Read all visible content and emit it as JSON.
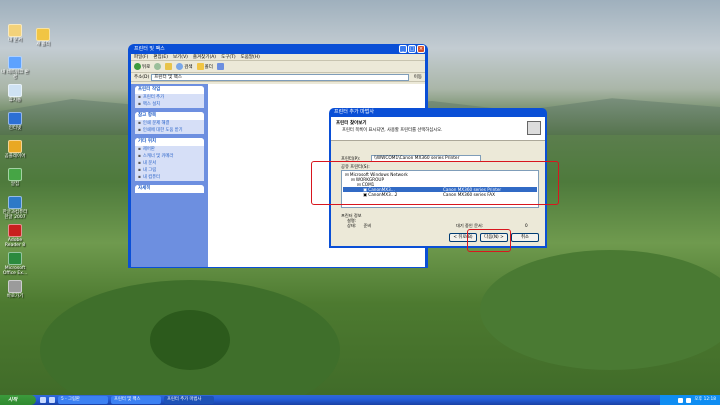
{
  "desktop_icons": [
    {
      "label": "내 문서"
    },
    {
      "label": "새 폴더"
    },
    {
      "label": "내 네트워크 환경"
    },
    {
      "label": "휴지통"
    },
    {
      "label": "인터넷"
    },
    {
      "label": "곰플레이어"
    },
    {
      "label": "알집"
    },
    {
      "label": "한글과컴퓨터 한글 2007"
    },
    {
      "label": "Adobe Reader 8"
    },
    {
      "label": "Microsoft Office Ex..."
    },
    {
      "label": "바로가기"
    }
  ],
  "main_window": {
    "title": "프린터 및 팩스",
    "menu": [
      "파일(F)",
      "편집(E)",
      "보기(V)",
      "즐겨찾기(A)",
      "도구(T)",
      "도움말(H)"
    ],
    "toolbar": {
      "back": "뒤로",
      "search": "검색",
      "folders": "폴더"
    },
    "address_label": "주소(D)",
    "address_value": "프린터 및 팩스",
    "go_label": "이동",
    "tasks": [
      {
        "header": "프린터 작업",
        "items": [
          "프린터 추가",
          "팩스 설치"
        ]
      },
      {
        "header": "참고 항목",
        "items": [
          "인쇄 문제 해결",
          "인쇄에 대한 도움 받기"
        ]
      },
      {
        "header": "기타 위치",
        "items": [
          "제어판",
          "스캐너 및 카메라",
          "내 문서",
          "내 그림",
          "내 컴퓨터"
        ]
      },
      {
        "header": "자세히",
        "items": []
      }
    ]
  },
  "dialog": {
    "title": "프린터 추가 마법사",
    "header_title": "프린터 찾아보기",
    "header_sub": "프린터 목록이 표시되면, 사용할 프린터를 선택하십시오.",
    "printer_label": "프린터(P):",
    "printer_value": "\\\\WWCOM1\\Canon MX360 series Printer",
    "shared_label": "공유 프린터(S):",
    "tree": [
      {
        "name": "Microsoft Windows Network",
        "model": ""
      },
      {
        "name": "WORKGROUP",
        "model": ""
      },
      {
        "name": "COM1",
        "model": ""
      },
      {
        "name": "CanonMX3...",
        "model": "Canon MX360 series Printer"
      },
      {
        "name": "CanonMX3...2",
        "model": "Canon MX360 series FAX"
      }
    ],
    "info_header": "프린터 정보",
    "comment_label": "설명:",
    "status_label": "상태:",
    "status_value": "준비",
    "queue_label": "대기 중인 문서:",
    "queue_value": "0",
    "back_button": "< 뒤로(B)",
    "next_button": "다음(N) >",
    "cancel_button": "취소"
  },
  "taskbar": {
    "start": "시작",
    "tasks": [
      "5 - 그림판",
      "프린터 및 팩스",
      "프린터 추가 마법사"
    ],
    "clock": "오후 12:18"
  },
  "colors": {
    "xp_blue": "#0a4fd6",
    "highlight": "#d8161e",
    "selection": "#316ac5"
  }
}
